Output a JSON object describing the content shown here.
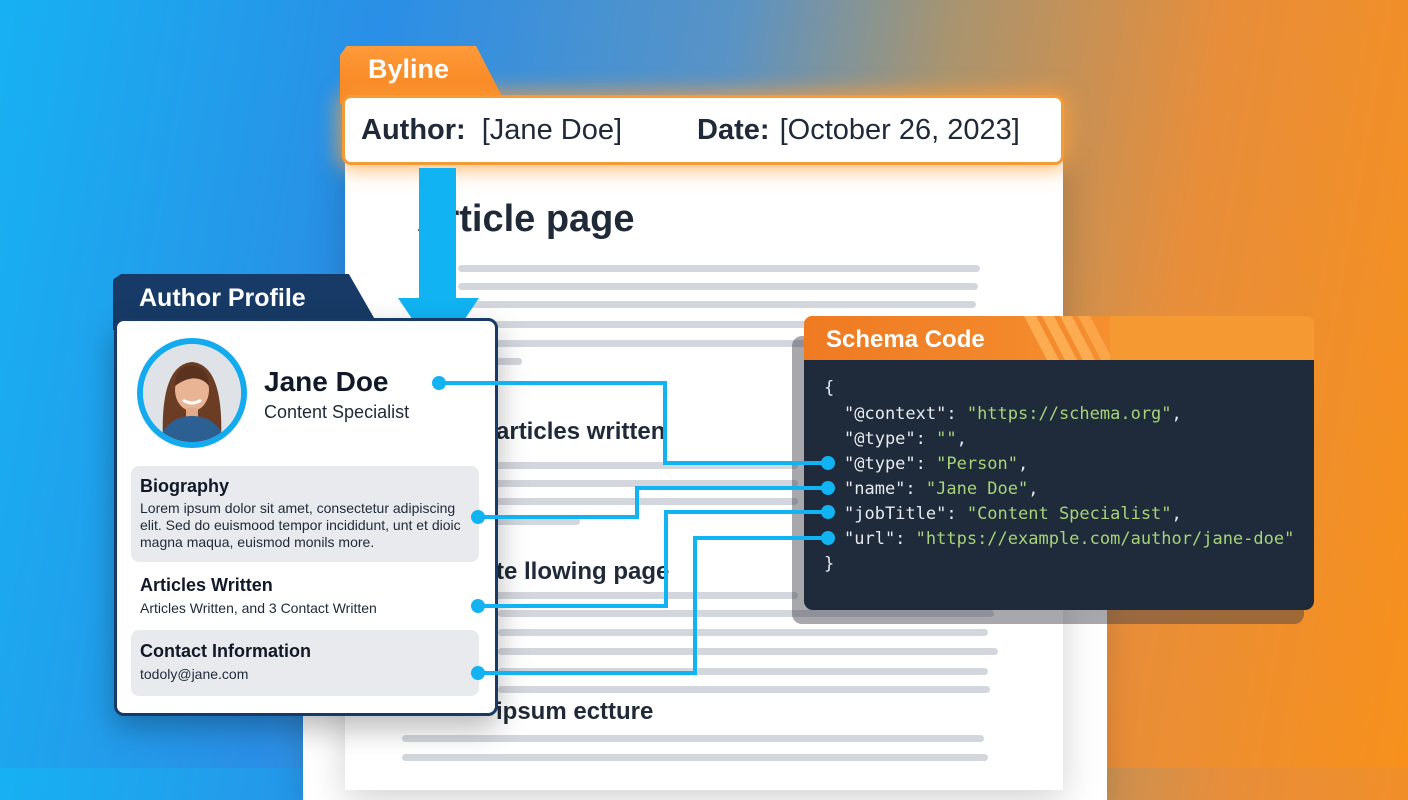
{
  "byline": {
    "tab_label": "Byline",
    "author_label": "Author:",
    "author_value": "[Jane Doe]",
    "date_label": "Date:",
    "date_value": "[October 26, 2023]"
  },
  "article": {
    "title": "Article page",
    "heading_1": "articles written",
    "heading_2": "te llowing page",
    "heading_3": "ipsum ectture"
  },
  "author_profile": {
    "tab_label": "Author Profile",
    "name": "Jane Doe",
    "role": "Content Specialist",
    "biography": {
      "title": "Biography",
      "text": "Lorem ipsum dolor sit amet, consectetur adipiscing elit. Sed do euismood tempor incididunt, unt et dioic magna maqua, euismod monils more."
    },
    "articles": {
      "title": "Articles Written",
      "text": "Articles Written, and 3 Contact Written"
    },
    "contact": {
      "title": "Contact Information",
      "text": "todoly@jane.com"
    }
  },
  "schema": {
    "tab_label": "Schema Code",
    "open_brace": "{",
    "close_brace": "}",
    "lines": [
      {
        "key": "\"@context\": ",
        "value": "\"https://schema.org\"",
        "suffix": ","
      },
      {
        "key": "\"@type\": ",
        "value": "\"\"",
        "suffix": ","
      },
      {
        "key": "\"@type\": ",
        "value": "\"Person\"",
        "suffix": ","
      },
      {
        "key": "\"name\": ",
        "value": "\"Jane Doe\"",
        "suffix": ","
      },
      {
        "key": "\"jobTitle\": ",
        "value": "\"Content Specialist\"",
        "suffix": ","
      },
      {
        "key": "\"url\": ",
        "value": "\"https://example.com/author/jane-doe\"",
        "suffix": ""
      }
    ]
  },
  "colors": {
    "accent_blue": "#11b3f3",
    "navy": "#173b66",
    "orange": "#f4811c",
    "code_bg": "#1f2a3a",
    "code_string": "#a7d37a"
  }
}
